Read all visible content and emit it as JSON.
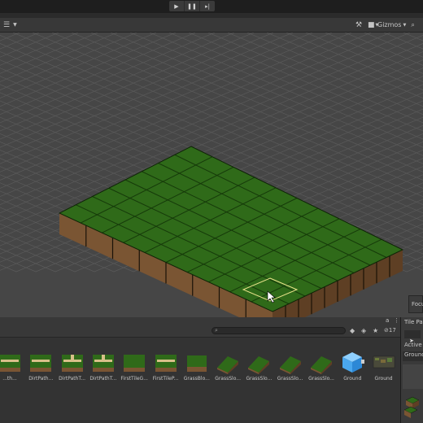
{
  "toolbar": {
    "play_icon": "play-icon",
    "pause_icon": "pause-icon",
    "step_icon": "step-icon"
  },
  "scene_toolbar": {
    "gizmos_label": "Gizmos",
    "layout_icon": "grid-menu-icon"
  },
  "scene": {
    "focus_label": "Focu"
  },
  "project": {
    "lock_icon": "lock-icon",
    "menu_icon": "kebab-icon",
    "count_label": "17",
    "search_value": "",
    "assets": [
      {
        "label": "...th...",
        "thumb": "dirtpath"
      },
      {
        "label": "DirtPath...",
        "thumb": "dirtpath"
      },
      {
        "label": "DirtPathT...",
        "thumb": "dirtpath-t"
      },
      {
        "label": "DirtPathT...",
        "thumb": "dirtpath-t2"
      },
      {
        "label": "FirstTileG...",
        "thumb": "grass"
      },
      {
        "label": "FirstTileP...",
        "thumb": "path"
      },
      {
        "label": "GrassBlo...",
        "thumb": "grassblock"
      },
      {
        "label": "GrassSlo...",
        "thumb": "slope"
      },
      {
        "label": "GrassSlo...",
        "thumb": "slope"
      },
      {
        "label": "GrassSlo...",
        "thumb": "slope"
      },
      {
        "label": "GrassSlo...",
        "thumb": "slope2"
      },
      {
        "label": "Ground",
        "thumb": "prefab"
      },
      {
        "label": "Ground",
        "thumb": "tilemap"
      }
    ]
  },
  "palette": {
    "title": "Tile Pale",
    "active_label": "Active",
    "ground_label": "Ground"
  },
  "colors": {
    "grass": "#2f6a19",
    "dirt": "#7a5533",
    "bg": "#464646"
  }
}
